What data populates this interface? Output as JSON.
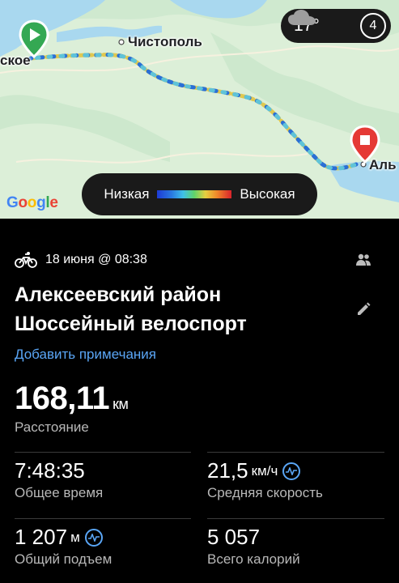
{
  "map": {
    "start_label": "ское",
    "city_label": "Чистополь",
    "end_label": "Аль",
    "google_logo": [
      "G",
      "o",
      "o",
      "g",
      "l",
      "e"
    ],
    "google_colors": [
      "#4285f4",
      "#ea4335",
      "#fbbc05",
      "#4285f4",
      "#34a853",
      "#ea4335"
    ]
  },
  "weather": {
    "temperature": "17°",
    "icon": "cloud-icon",
    "count": "4"
  },
  "legend": {
    "low_label": "Низкая",
    "high_label": "Высокая"
  },
  "activity": {
    "sport_icon": "bicycle-icon",
    "date_time": "18 июня @ 08:38",
    "title_line1": "Алексеевский район",
    "title_line2": "Шоссейный велоспорт",
    "add_notes": "Добавить примечания"
  },
  "distance": {
    "value": "168,11",
    "unit": "км",
    "label": "Расстояние"
  },
  "stats": {
    "total_time": {
      "value": "7:48:35",
      "label": "Общее время"
    },
    "avg_speed": {
      "value": "21,5",
      "unit": "км/ч",
      "label": "Средняя скорость"
    },
    "elevation": {
      "value": "1 207",
      "unit": "м",
      "label": "Общий подъем"
    },
    "calories": {
      "value": "5 057",
      "label": "Всего калорий"
    }
  },
  "colors": {
    "accent": "#5aa6f6",
    "start_pin": "#34a853",
    "end_pin": "#e53935",
    "background": "#000000"
  }
}
